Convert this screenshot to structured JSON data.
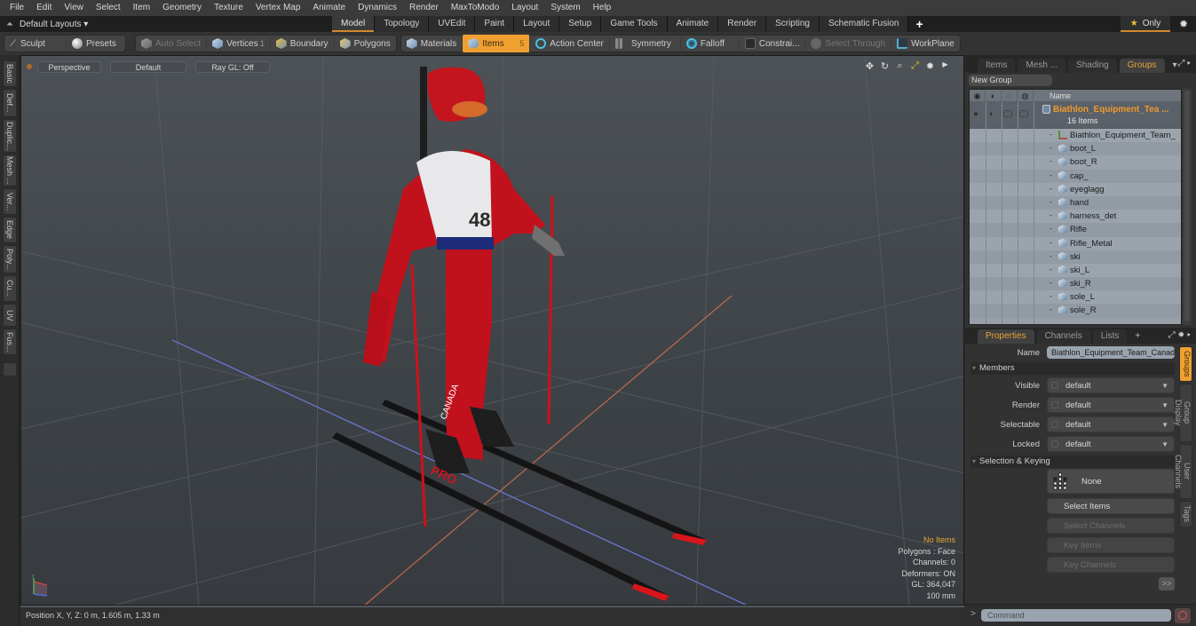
{
  "menubar": {
    "items": [
      "File",
      "Edit",
      "View",
      "Select",
      "Item",
      "Geometry",
      "Texture",
      "Vertex Map",
      "Animate",
      "Dynamics",
      "Render",
      "MaxToModo",
      "Layout",
      "System",
      "Help"
    ]
  },
  "layoutbar": {
    "layouts_label": "Default Layouts ▾",
    "tabs": [
      "Model",
      "Topology",
      "UVEdit",
      "Paint",
      "Layout",
      "Setup",
      "Game Tools",
      "Animate",
      "Render",
      "Scripting",
      "Schematic Fusion"
    ],
    "active_tab": "Model",
    "add_tab": "+",
    "only_label": "Only"
  },
  "toolbar": {
    "sculpt": "Sculpt",
    "presets": "Presets",
    "auto_select": "Auto Select",
    "vertices": "Vertices",
    "vertices_count": "1",
    "boundary": "Boundary",
    "polygons": "Polygons",
    "materials": "Materials",
    "items": "Items",
    "items_count": "5",
    "action_center": "Action Center",
    "symmetry": "Symmetry",
    "falloff": "Falloff",
    "constraints": "Constrai...",
    "select_through": "Select Through",
    "workplane": "WorkPlane"
  },
  "left_tabs": [
    "Basic",
    "Def...",
    "Duplic...",
    "Mesh ...",
    "Ver...",
    "Edge",
    "Poly...",
    "Cu...",
    "UV",
    "Fus..."
  ],
  "viewport": {
    "view_mode": "Perspective",
    "shading": "Default",
    "raygl": "Ray GL: Off",
    "stats": {
      "selection": "No Items",
      "polygons": "Polygons : Face",
      "channels": "Channels: 0",
      "deformers": "Deformers: ON",
      "gl": "GL: 364,047",
      "unit": "100 mm"
    },
    "model_labels": {
      "bib_number": "48",
      "leg_text": "CANADA",
      "boot_text": "PRO"
    }
  },
  "statusbar": {
    "position": "Position X, Y, Z:   0 m, 1.605 m, 1.33 m"
  },
  "groups_panel": {
    "tabs": [
      "Items",
      "Mesh ...",
      "Shading",
      "Groups"
    ],
    "active_tab": "Groups",
    "new_group": "New Group",
    "name_header": "Name",
    "group_name": "Biathlon_Equipment_Tea ...",
    "group_count": "16 Items",
    "items": [
      {
        "label": "Biathlon_Equipment_Team_ ...",
        "type": "locator"
      },
      {
        "label": "boot_L",
        "type": "mesh"
      },
      {
        "label": "boot_R",
        "type": "mesh"
      },
      {
        "label": "cap_",
        "type": "mesh"
      },
      {
        "label": "eyeglagg",
        "type": "mesh"
      },
      {
        "label": "hand",
        "type": "mesh"
      },
      {
        "label": "harness_det",
        "type": "mesh"
      },
      {
        "label": "Rifle",
        "type": "mesh"
      },
      {
        "label": "Rifle_Metal",
        "type": "mesh"
      },
      {
        "label": "ski",
        "type": "mesh"
      },
      {
        "label": "ski_L",
        "type": "mesh"
      },
      {
        "label": "ski_R",
        "type": "mesh"
      },
      {
        "label": "sole_L",
        "type": "mesh"
      },
      {
        "label": "sole_R",
        "type": "mesh"
      }
    ]
  },
  "properties_panel": {
    "tabs": [
      "Properties",
      "Channels",
      "Lists"
    ],
    "active_tab": "Properties",
    "add_tab": "+",
    "name_label": "Name",
    "name_value": "Biathlon_Equipment_Team_Canada",
    "members_header": "Members",
    "visible_label": "Visible",
    "visible_value": "default",
    "render_label": "Render",
    "render_value": "default",
    "selectable_label": "Selectable",
    "selectable_value": "default",
    "locked_label": "Locked",
    "locked_value": "default",
    "selkey_header": "Selection & Keying",
    "none_btn": "None",
    "select_items": "Select Items",
    "select_channels": "Select Channels",
    "key_items": "Key Items",
    "key_channels": "Key Channels",
    "more": ">>",
    "side_tabs": [
      "Groups",
      "Group Display",
      "User Channels",
      "Tags"
    ],
    "active_side_tab": "Groups"
  },
  "command": {
    "prompt": ">",
    "placeholder": "Command"
  }
}
